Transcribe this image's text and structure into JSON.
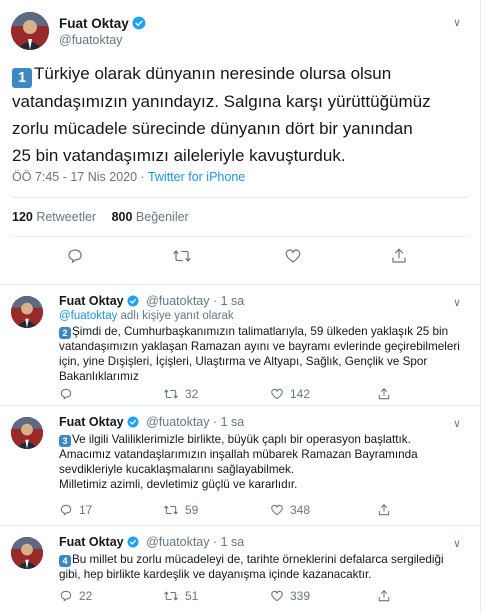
{
  "colors": {
    "accent": "#1b95e0",
    "secondary_text": "#657786",
    "keycap": "#3b88c3",
    "verified": "#1da1f2"
  },
  "main_tweet": {
    "author_name": "Fuat Oktay",
    "handle": "@fuatoktay",
    "keycap": "1",
    "text_line1": "Türkiye olarak dünyanın neresinde olursa olsun",
    "text_line2": "vatandaşımızın yanındayız. Salgına karşı yürüttüğümüz",
    "text_line3": "zorlu mücadele sürecinde dünyanın dört bir yanından",
    "text_line4": "25 bin vatandaşımızı aileleriyle kavuşturduk.",
    "time": "ÖÖ 7:45 - 17 Nis 2020 · ",
    "via": "Twitter for iPhone",
    "retweets_count": "120",
    "retweets_label": " Retweetler",
    "likes_count": "800",
    "likes_label": " Beğeniler",
    "icons": [
      "reply-icon",
      "retweet-icon",
      "like-icon",
      "share-icon"
    ]
  },
  "replies": [
    {
      "name": "Fuat Oktay",
      "handle": "@fuatoktay",
      "time": " · 1 sa",
      "replying_mention": "@fuatoktay",
      "replying_rest": " adlı kişiye yanıt olarak",
      "keycap": "2",
      "lines": [
        "Şimdi de, Cumhurbaşkanımızın talimatlarıyla, 59 ülkeden yaklaşık 25 bin",
        "vatandaşımızın yaklaşan Ramazan ayını ve bayramı evlerinde geçirebilmeleri",
        "için, yine Dışişleri, İçişleri, Ulaştırma ve Altyapı, Sağlık, Gençlik ve Spor",
        "Bakanlıklarımız"
      ],
      "reply_count": "",
      "retweet_count": "32",
      "like_count": "142"
    },
    {
      "name": "Fuat Oktay",
      "handle": "@fuatoktay",
      "time": " · 1 sa",
      "keycap": "3",
      "lines": [
        "Ve ilgili Valiliklerimizle birlikte, büyük çaplı bir operasyon başlattık.",
        "Amacımız vatandaşlarımızın inşallah mübarek Ramazan Bayramında",
        "sevdikleriyle kucaklaşmalarını sağlayabilmek.",
        "Milletimiz azimli, devletimiz güçlü ve kararlıdır."
      ],
      "reply_count": "17",
      "retweet_count": "59",
      "like_count": "348"
    },
    {
      "name": "Fuat Oktay",
      "handle": "@fuatoktay",
      "time": " · 1 sa",
      "keycap": "4",
      "lines": [
        "Bu millet bu zorlu mücadeleyi de, tarihte örneklerini defalarca sergilediği",
        "gibi, hep birlikte kardeşlik ve dayanışma içinde kazanacaktır."
      ],
      "reply_count": "22",
      "retweet_count": "51",
      "like_count": "339"
    }
  ]
}
